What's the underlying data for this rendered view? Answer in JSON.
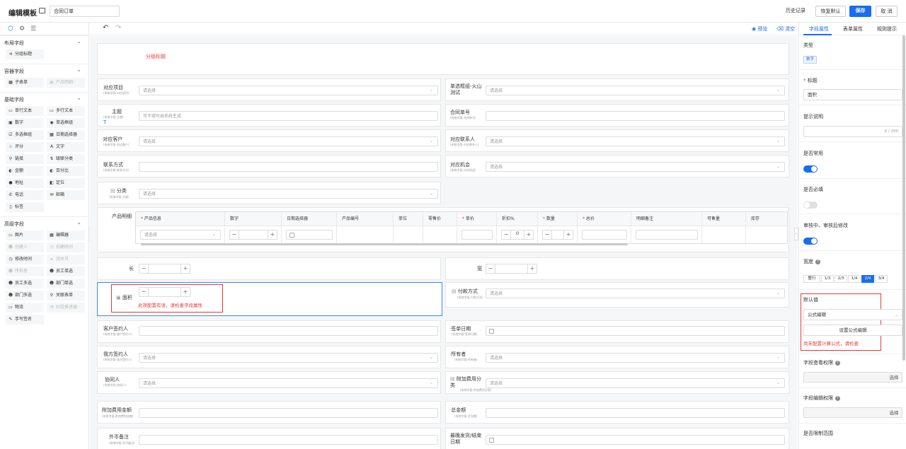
{
  "header": {
    "title": "编辑模板",
    "name_value": "合同订单",
    "history": "历史记录",
    "restore": "恢复默认",
    "save": "保存",
    "cancel": "取 消"
  },
  "toolbar": {
    "preview": "预览",
    "clear": "清空"
  },
  "left_panel": {
    "sections": [
      {
        "title": "布局字段",
        "items": [
          {
            "label": "分组标题",
            "icon": "⊲"
          }
        ]
      },
      {
        "title": "容器字段",
        "items": [
          {
            "label": "子表单",
            "icon": "▦"
          },
          {
            "label": "产品明细",
            "icon": "▤",
            "disabled": true
          }
        ]
      },
      {
        "title": "基础字段",
        "items": [
          {
            "label": "单行文本",
            "icon": "▭"
          },
          {
            "label": "多行文本",
            "icon": "▭"
          },
          {
            "label": "数字",
            "icon": "▣"
          },
          {
            "label": "单选框组",
            "icon": "◉"
          },
          {
            "label": "多选框组",
            "icon": "☑"
          },
          {
            "label": "日期选择器",
            "icon": "▦"
          },
          {
            "label": "评分",
            "icon": "☆"
          },
          {
            "label": "文字",
            "icon": "A"
          },
          {
            "label": "链接",
            "icon": "⚲"
          },
          {
            "label": "级联分类",
            "icon": "⇅"
          },
          {
            "label": "金额",
            "icon": "◐"
          },
          {
            "label": "百分比",
            "icon": "◐"
          },
          {
            "label": "地址",
            "icon": "●"
          },
          {
            "label": "定位",
            "icon": "◧"
          },
          {
            "label": "电话",
            "icon": "✆"
          },
          {
            "label": "邮箱",
            "icon": "✉"
          },
          {
            "label": "标签",
            "icon": "▯"
          }
        ]
      },
      {
        "title": "高级字段",
        "items": [
          {
            "label": "图片",
            "icon": "▭"
          },
          {
            "label": "编辑器",
            "icon": "▦"
          },
          {
            "label": "创建人",
            "icon": "☻",
            "disabled": true
          },
          {
            "label": "创建时间",
            "icon": "◷",
            "disabled": true
          },
          {
            "label": "修改时间",
            "icon": "◷"
          },
          {
            "label": "流水号",
            "icon": "≡",
            "disabled": true
          },
          {
            "label": "所有者",
            "icon": "☻",
            "disabled": true
          },
          {
            "label": "员工单选",
            "icon": "☻"
          },
          {
            "label": "员工多选",
            "icon": "☻"
          },
          {
            "label": "部门单选",
            "icon": "☻"
          },
          {
            "label": "部门多选",
            "icon": "☻"
          },
          {
            "label": "关联表单",
            "icon": "⚲"
          },
          {
            "label": "物流",
            "icon": "▭"
          },
          {
            "label": "阶段推进器",
            "icon": "◔",
            "disabled": true
          },
          {
            "label": "手写签名",
            "icon": "✎"
          }
        ]
      }
    ]
  },
  "form": {
    "group_title": "分组标题",
    "placeholder_select": "请选择",
    "fields": {
      "related_project": {
        "label": "对应项目",
        "sub": "(系统字段-对应项目)"
      },
      "single_select": {
        "label": "单选框组-火山测试"
      },
      "subject": {
        "label": "主题",
        "sub": "(系统字段-主题)",
        "placeholder": "可不填写由系统生成"
      },
      "contract_no": {
        "label": "合同单号",
        "sub": "(系统字段-合同单号)"
      },
      "customer": {
        "label": "对应客户",
        "sub": "(系统字段-对应客户)"
      },
      "contact": {
        "label": "对应联系人",
        "sub": "(系统字段-对应联系人)"
      },
      "contact_way": {
        "label": "联系方式",
        "sub": "(系统字段-联系方式)"
      },
      "opportunity": {
        "label": "对应机会",
        "sub": "(系统字段-对应机会)"
      },
      "category": {
        "label": "分类",
        "sub": "(系统字段-分类)"
      },
      "product_detail": {
        "label": "产品明细"
      },
      "length": {
        "label": "长"
      },
      "width": {
        "label": "宽"
      },
      "area": {
        "label": "面积",
        "error": "此项配置有误，请检查字段属性"
      },
      "pay_method": {
        "label": "付款方式",
        "sub": "(系统字段-付款方式)"
      },
      "customer_signer": {
        "label": "客户签约人",
        "sub": "(系统字段-客户签约人)"
      },
      "sign_date": {
        "label": "签单日期",
        "sub": "(系统字段-签单日期)"
      },
      "our_signer": {
        "label": "我方签约人",
        "sub": "(系统字段-我方签约人)"
      },
      "owner": {
        "label": "所有者",
        "sub": "(系统字段-所有者)"
      },
      "collaborator": {
        "label": "协同人",
        "sub": "(系统字段-协同人)"
      },
      "extra_fee_cat": {
        "label": "附加费用分类",
        "sub": "(系统字段-附加费用分类)"
      },
      "extra_fee_amount": {
        "label": "附加费用金额",
        "sub": "(系统字段-附加费用金额)"
      },
      "total": {
        "label": "总金额",
        "sub": "(系统字段-总金额)"
      },
      "fx_note": {
        "label": "外币备注",
        "sub": "(系统字段-外币备注)"
      },
      "latest_date": {
        "label": "最晚发货/结束日期"
      }
    },
    "table_headers": [
      "产品信息",
      "数字",
      "日期选择器",
      "产品编号",
      "单位",
      "零售价",
      "单价",
      "折扣%",
      "数量",
      "总价",
      "明细备注",
      "可售量",
      "库存"
    ],
    "table_required": [
      true,
      false,
      false,
      false,
      false,
      false,
      true,
      false,
      true,
      true,
      false,
      false,
      false
    ],
    "discount_value": "0"
  },
  "right_panel": {
    "tabs": [
      "字段属性",
      "表单属性",
      "规则提示"
    ],
    "type_label": "类型",
    "type_value": "数字",
    "title_label": "标题",
    "title_value": "面积",
    "hint_label": "提示说明",
    "hint_counter": "0 / 200",
    "common_label": "是否常用",
    "required_label": "是否必填",
    "approval_label": "审核中、审核后修改",
    "width_label": "宽度",
    "width_options": [
      "整行",
      "1/3",
      "2/3",
      "1/4",
      "2/4",
      "3/4"
    ],
    "width_selected": "2/4",
    "default_label": "默认值",
    "default_mode": "公式编辑",
    "formula_button": "设置公式编辑",
    "formula_error": "尚未配置计算公式，请检查",
    "view_perm_label": "字段查看权限",
    "edit_perm_label": "字段编辑权限",
    "select_label": "选择",
    "limit_label": "是否限制范围"
  },
  "colors": {
    "accent": "#1a6cf0",
    "error": "#e53935"
  }
}
